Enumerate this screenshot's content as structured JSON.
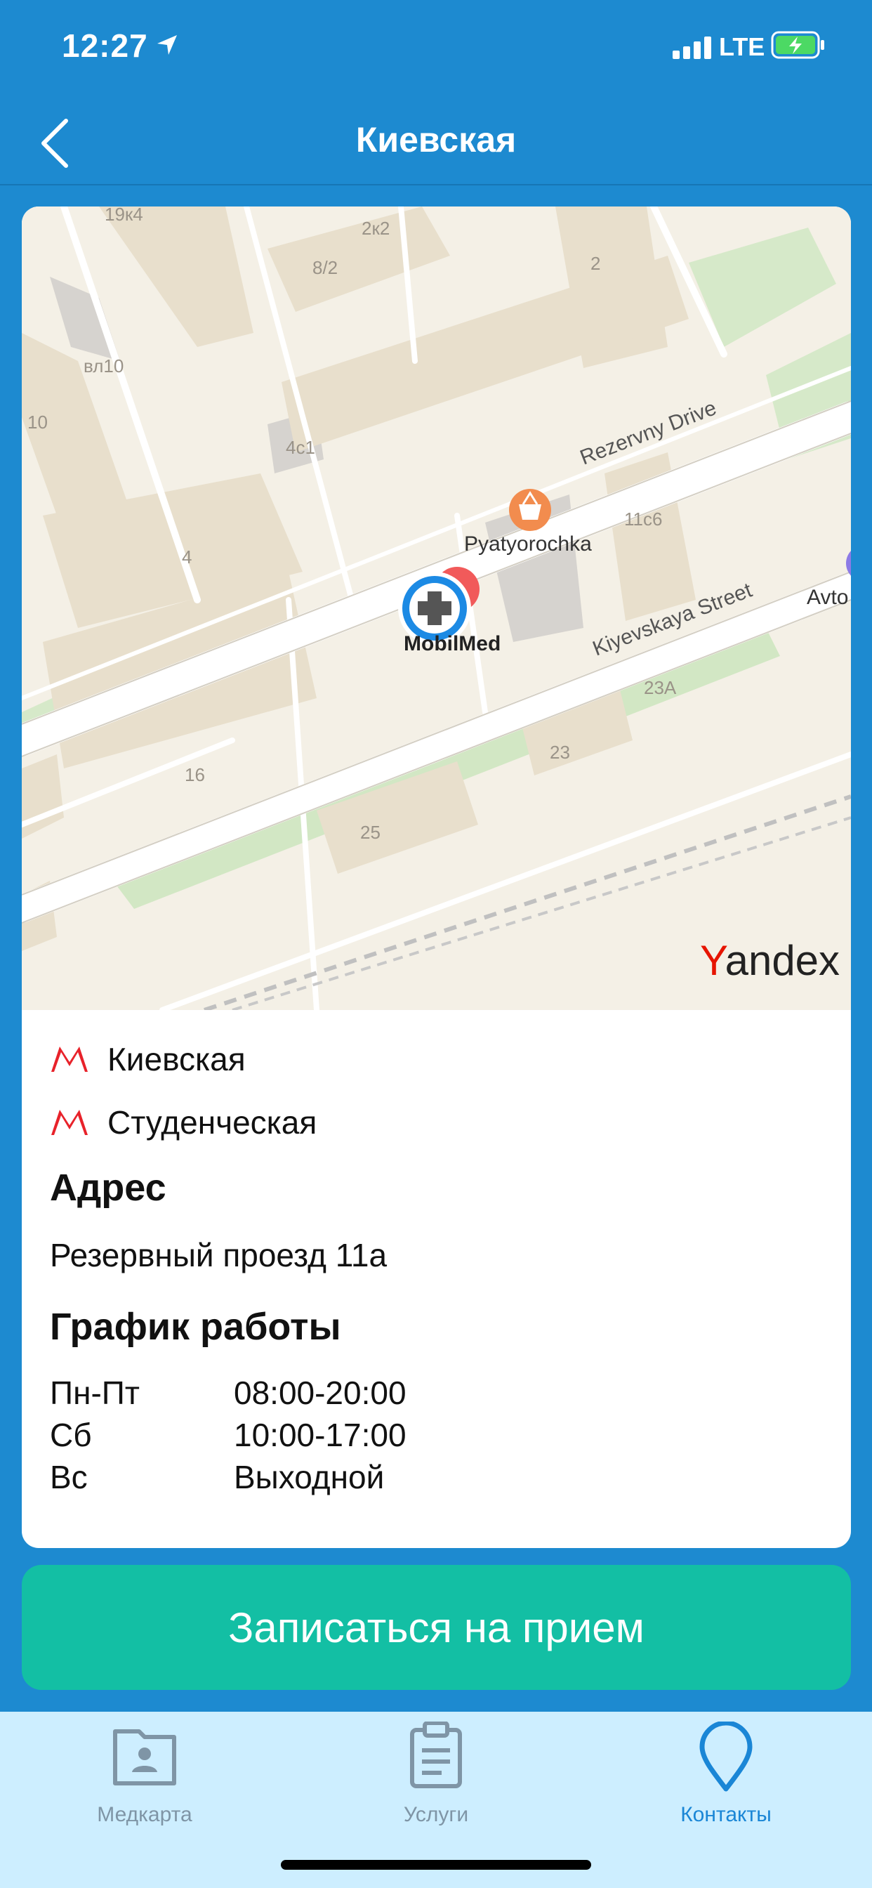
{
  "status_bar": {
    "time": "12:27",
    "network": "LTE"
  },
  "nav": {
    "title": "Киевская"
  },
  "map": {
    "labels": {
      "b19k4": "19к4",
      "b2k2": "2к2",
      "b8_2": "8/2",
      "b2": "2",
      "bvl10": "вл10",
      "b10": "10",
      "b4s1": "4с1",
      "b4": "4",
      "b11s6": "11с6",
      "b16": "16",
      "b23a": "23A",
      "b23": "23",
      "b25": "25",
      "street1": "Rezervny Drive",
      "street2": "Kiyevskaya Street",
      "poi_shop": "Pyatyorochka",
      "poi_clinic": "MobilMed",
      "poi_cut": "Avto",
      "provider": "Yandex"
    }
  },
  "metro": [
    {
      "name": "Киевская"
    },
    {
      "name": "Студенческая"
    }
  ],
  "address": {
    "title": "Адрес",
    "value": "Резервный проезд 11а"
  },
  "schedule": {
    "title": "График работы",
    "rows": [
      {
        "day": "Пн-Пт",
        "time": "08:00-20:00"
      },
      {
        "day": "Сб",
        "time": "10:00-17:00"
      },
      {
        "day": "Вс",
        "time": "Выходной"
      }
    ]
  },
  "actions": {
    "book_label": "Записаться на прием"
  },
  "tabs": [
    {
      "label": "Медкарта",
      "icon": "medical-card-icon",
      "active": false
    },
    {
      "label": "Услуги",
      "icon": "clipboard-icon",
      "active": false
    },
    {
      "label": "Контакты",
      "icon": "location-pin-icon",
      "active": true
    }
  ],
  "colors": {
    "header": "#1d8ad0",
    "button": "#13bfa4",
    "tab_bar": "#cdeeff",
    "tab_active": "#1a86d6",
    "tab_inactive": "#7f95a6",
    "metro": "#e8222a"
  }
}
